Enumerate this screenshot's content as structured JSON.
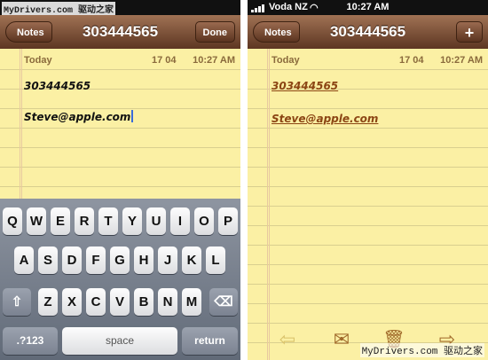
{
  "left": {
    "status": {
      "watermark": "MyDrivers.com 驱动之家"
    },
    "nav": {
      "back_label": "Notes",
      "title": "303444565",
      "done_label": "Done"
    },
    "note": {
      "today": "Today",
      "date": "17 04",
      "time": "10:27 AM",
      "line1": "303444565",
      "line2": "Steve@apple.com"
    },
    "keyboard": {
      "row1": [
        "Q",
        "W",
        "E",
        "R",
        "T",
        "Y",
        "U",
        "I",
        "O",
        "P"
      ],
      "row2": [
        "A",
        "S",
        "D",
        "F",
        "G",
        "H",
        "J",
        "K",
        "L"
      ],
      "row3": [
        "Z",
        "X",
        "C",
        "V",
        "B",
        "N",
        "M"
      ],
      "shift_glyph": "⇧",
      "delete_glyph": "⌫",
      "numbers_label": ".?123",
      "space_label": "space",
      "return_label": "return"
    }
  },
  "right": {
    "status": {
      "carrier": "Voda NZ",
      "wifi_glyph": "◠",
      "clock": "10:27 AM"
    },
    "nav": {
      "back_label": "Notes",
      "title": "303444565",
      "plus_label": "+"
    },
    "note": {
      "today": "Today",
      "date": "17 04",
      "time": "10:27 AM",
      "line1": "303444565",
      "line2": "Steve@apple.com"
    },
    "toolbar": {
      "back_glyph": "⇦",
      "mail_glyph": "✉",
      "trash_glyph": "🗑",
      "forward_glyph": "⇨"
    },
    "watermark": "MyDrivers.com 驱动之家"
  },
  "colors": {
    "paper": "#fbf0a4",
    "nav": "#5d3622",
    "link": "#8b4513"
  }
}
